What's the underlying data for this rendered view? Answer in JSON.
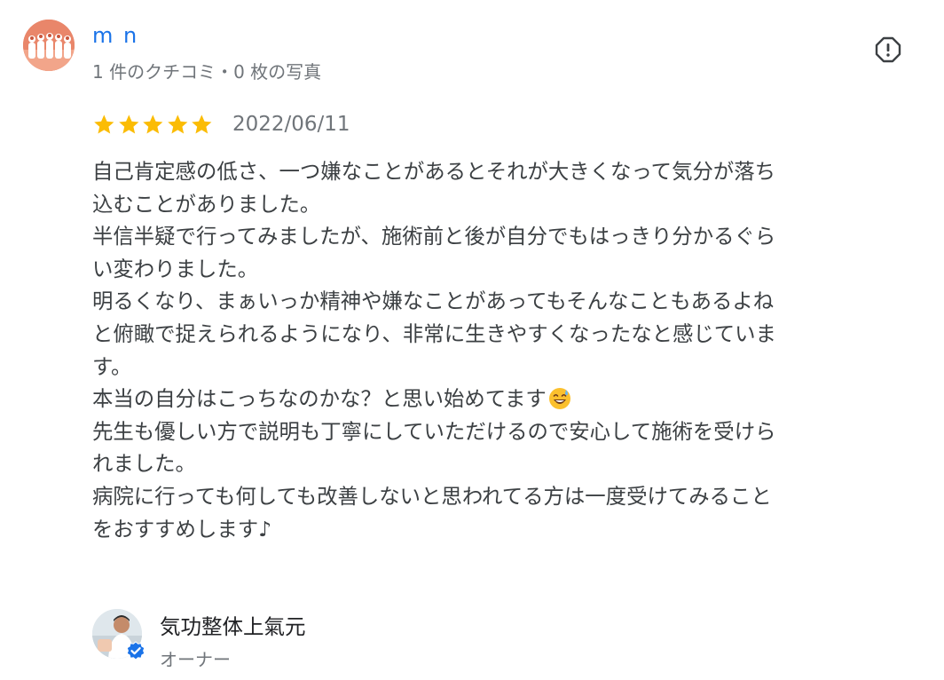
{
  "reviewer": {
    "name": "m n",
    "meta": "1 件のクチコミ・0 枚の写真",
    "avatar_icon": "group-photo-avatar"
  },
  "report": {
    "icon": "report-icon"
  },
  "review": {
    "rating": 5,
    "rating_max": 5,
    "date": "2022/06/11",
    "lines": [
      "自己肯定感の低さ、一つ嫌なことがあるとそれが大きくなって気分が落ち",
      "込むことがありました。",
      "半信半疑で行ってみましたが、施術前と後が自分でもはっきり分かるぐら",
      "い変わりました。",
      "明るくなり、まぁいっか精神や嫌なことがあってもそんなこともあるよね",
      "と俯瞰で捉えられるようになり、非常に生きやすくなったなと感じていま",
      "す。",
      "本当の自分はこっちなのかな？と思い始めてます",
      "先生も優しい方で説明も丁寧にしていただけるので安心して施術を受けら",
      "れました。",
      "病院に行っても何しても改善しないと思われてる方は一度受けてみること",
      "をおすすめします♪"
    ],
    "emoji_icon": "grinning-sweat-emoji-icon"
  },
  "owner": {
    "name": "気功整体上氣元",
    "role": "オーナー",
    "verified_icon": "verified-check-icon"
  },
  "colors": {
    "link_blue": "#1a73e8",
    "star_gold": "#fbbc04",
    "text_dark": "#3c4043",
    "text_muted": "#70757a",
    "badge_blue": "#1a73e8"
  }
}
